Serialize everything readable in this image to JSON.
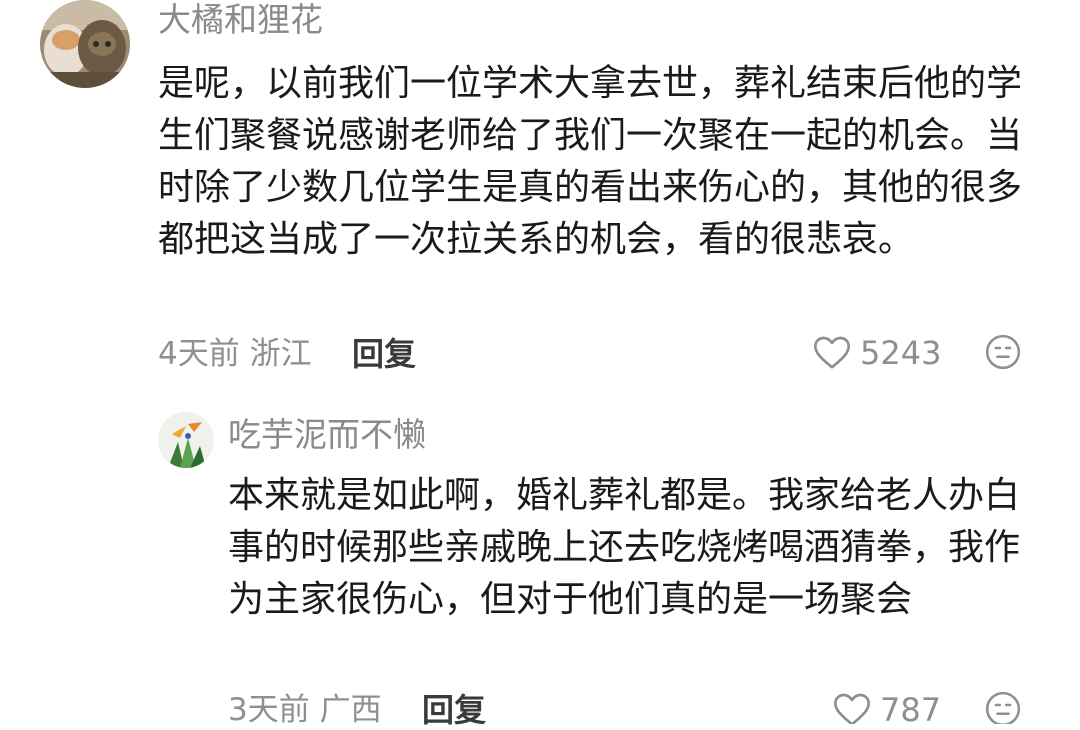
{
  "comments": [
    {
      "username": "大橘和狸花",
      "avatar_icon": "cat-avatar-icon",
      "content": "是呢，以前我们一位学术大拿去世，葬礼结束后他的学生们聚餐说感谢老师给了我们一次聚在一起的机会。当时除了少数几位学生是真的看出来伤心的，其他的很多都把这当成了一次拉关系的机会，看的很悲哀。",
      "meta": "4天前 浙江",
      "reply_label": "回复",
      "likes": "5243",
      "like_icon": "heart-outline-icon",
      "face_icon": "neutral-face-icon"
    },
    {
      "username": "吃芋泥而不懒",
      "avatar_icon": "plant-avatar-icon",
      "content": "本来就是如此啊，婚礼葬礼都是。我家给老人办白事的时候那些亲戚晚上还去吃烧烤喝酒猜拳，我作为主家很伤心，但对于他们真的是一场聚会",
      "meta": "3天前 广西",
      "reply_label": "回复",
      "likes": "787",
      "like_icon": "heart-outline-icon",
      "face_icon": "neutral-face-icon"
    }
  ],
  "colors": {
    "text_primary": "#1a1a1a",
    "text_secondary": "#8a8a8a",
    "reply_text": "#3a3a3a",
    "background": "#ffffff"
  }
}
